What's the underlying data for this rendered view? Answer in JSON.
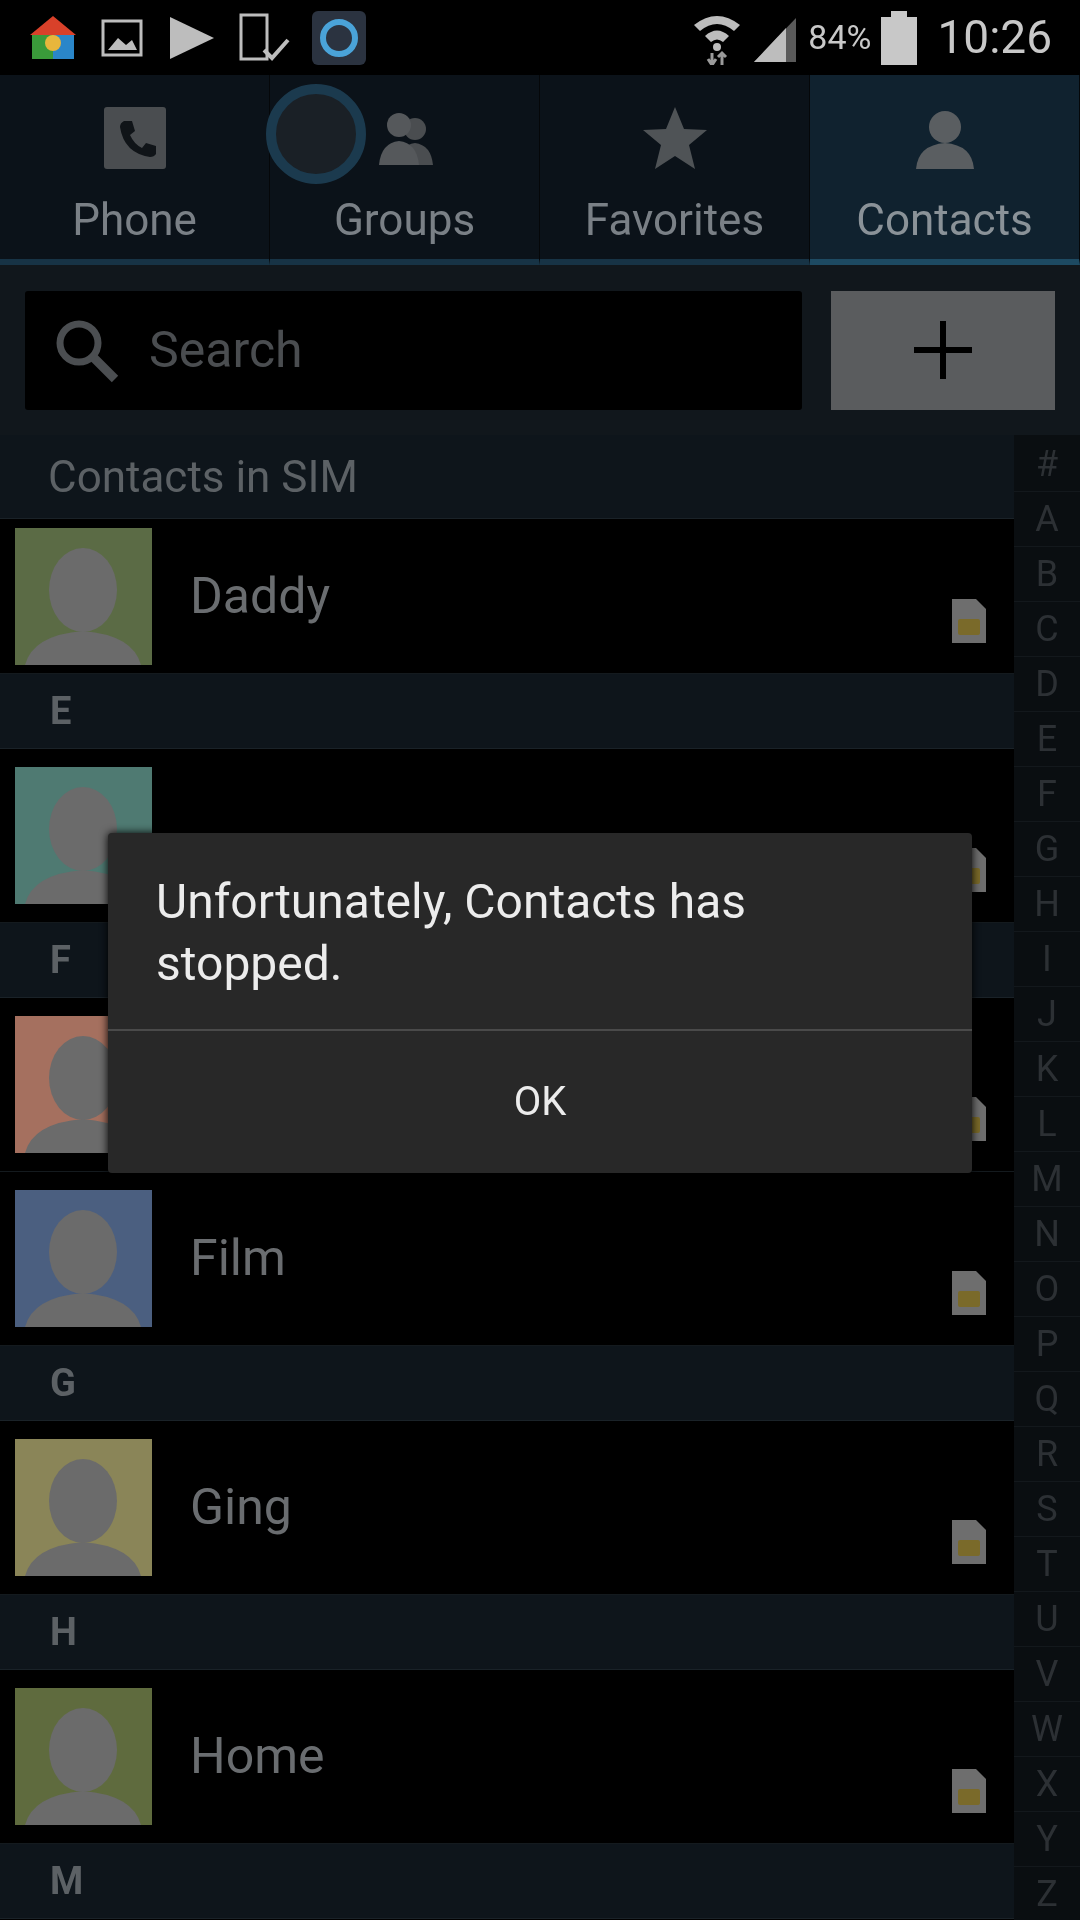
{
  "status_bar": {
    "battery": "84%",
    "time": "10:26"
  },
  "tabs": [
    {
      "kind": "phone",
      "label": "Phone",
      "selected": false
    },
    {
      "kind": "groups",
      "label": "Groups",
      "selected": false,
      "pressed": true
    },
    {
      "kind": "favorites",
      "label": "Favorites",
      "selected": false
    },
    {
      "kind": "contacts",
      "label": "Contacts",
      "selected": true
    }
  ],
  "search": {
    "placeholder": "Search"
  },
  "list": [
    {
      "kind": "header",
      "label": "Contacts in SIM"
    },
    {
      "kind": "contact",
      "name": "Daddy",
      "color": "#5b6b45"
    },
    {
      "kind": "header",
      "label": "E"
    },
    {
      "kind": "contact",
      "color": "#4f7a72"
    },
    {
      "kind": "header",
      "label": "F"
    },
    {
      "kind": "contact",
      "color": "#a5705f"
    },
    {
      "kind": "contact",
      "name": "Film",
      "color": "#4b5f80"
    },
    {
      "kind": "header",
      "label": "G"
    },
    {
      "kind": "contact",
      "name": "Ging",
      "color": "#8a8558"
    },
    {
      "kind": "header",
      "label": "H"
    },
    {
      "kind": "contact",
      "name": "Home",
      "color": "#5f6b3e"
    },
    {
      "kind": "header",
      "label": "M"
    }
  ],
  "index": [
    "#",
    "A",
    "B",
    "C",
    "D",
    "E",
    "F",
    "G",
    "H",
    "I",
    "J",
    "K",
    "L",
    "M",
    "N",
    "O",
    "P",
    "Q",
    "R",
    "S",
    "T",
    "U",
    "V",
    "W",
    "X",
    "Y",
    "Z"
  ],
  "dialog": {
    "message": "Unfortunately, Contacts has stopped.",
    "button": "OK"
  }
}
